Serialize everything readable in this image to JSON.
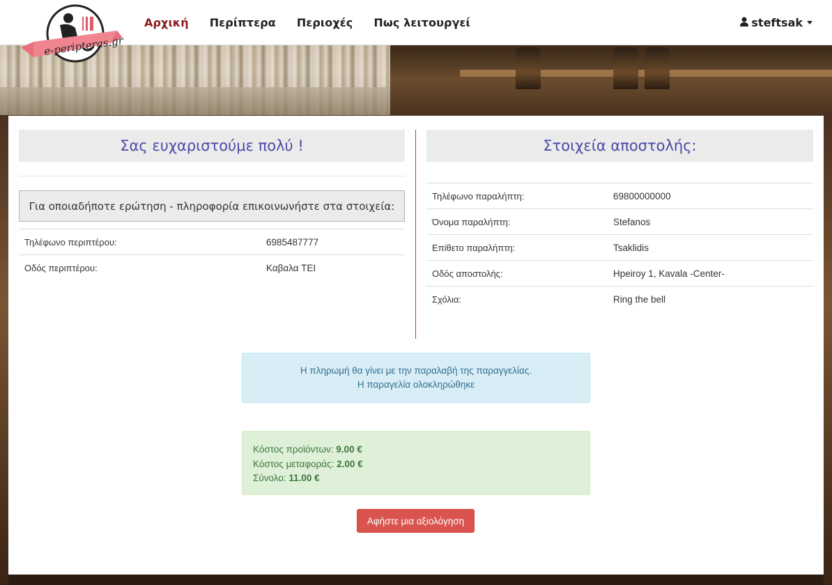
{
  "nav": {
    "brand": "e-peripteras.gr",
    "links": [
      {
        "label": "Αρχική",
        "active": true
      },
      {
        "label": "Περίπτερα",
        "active": false
      },
      {
        "label": "Περιοχές",
        "active": false
      },
      {
        "label": "Πως λειτουργεί",
        "active": false
      }
    ],
    "user": "steftsak"
  },
  "left": {
    "heading": "Σας ευχαριστούμε πολύ !",
    "contact_prompt": "Για οποιαδήποτε ερώτηση - πληροφορία επικοινωνήστε στα στοιχεία:",
    "rows": [
      {
        "label": "Τηλέφωνο περιπτέρου:",
        "value": "6985487777"
      },
      {
        "label": "Οδός περιπτέρου:",
        "value": "Καβαλα ΤΕΙ"
      }
    ]
  },
  "right": {
    "heading": "Στοιχεία αποστολής:",
    "rows": [
      {
        "label": "Τηλέφωνο παραλήπτη:",
        "value": "69800000000"
      },
      {
        "label": "Όνομα παραλήπτη:",
        "value": "Stefanos"
      },
      {
        "label": "Επίθετο παραλήπτη:",
        "value": "Tsaklidis"
      },
      {
        "label": "Οδός αποστολής:",
        "value": "Hpeiroy 1, Kavala -Center-"
      },
      {
        "label": "Σχόλια:",
        "value": "Ring the bell"
      }
    ]
  },
  "info_alert": {
    "line1": "Η πληρωμή θα γίνει με την παραλαβή της παραγγελίας.",
    "line2": "Η παραγελία ολοκληρώθηκε"
  },
  "costs": {
    "products_label": "Κόστος προϊόντων:",
    "products_value": "9.00 €",
    "shipping_label": "Κόστος μεταφοράς:",
    "shipping_value": "2.00 €",
    "total_label": "Σύνολο:",
    "total_value": "11.00 €"
  },
  "review_button": "Αφήστε μια αξιολόγηση",
  "colors": {
    "heading": "#4a4aa6",
    "active_nav": "#8b1d1d",
    "divider": "#c9302c",
    "button": "#d9534f"
  }
}
